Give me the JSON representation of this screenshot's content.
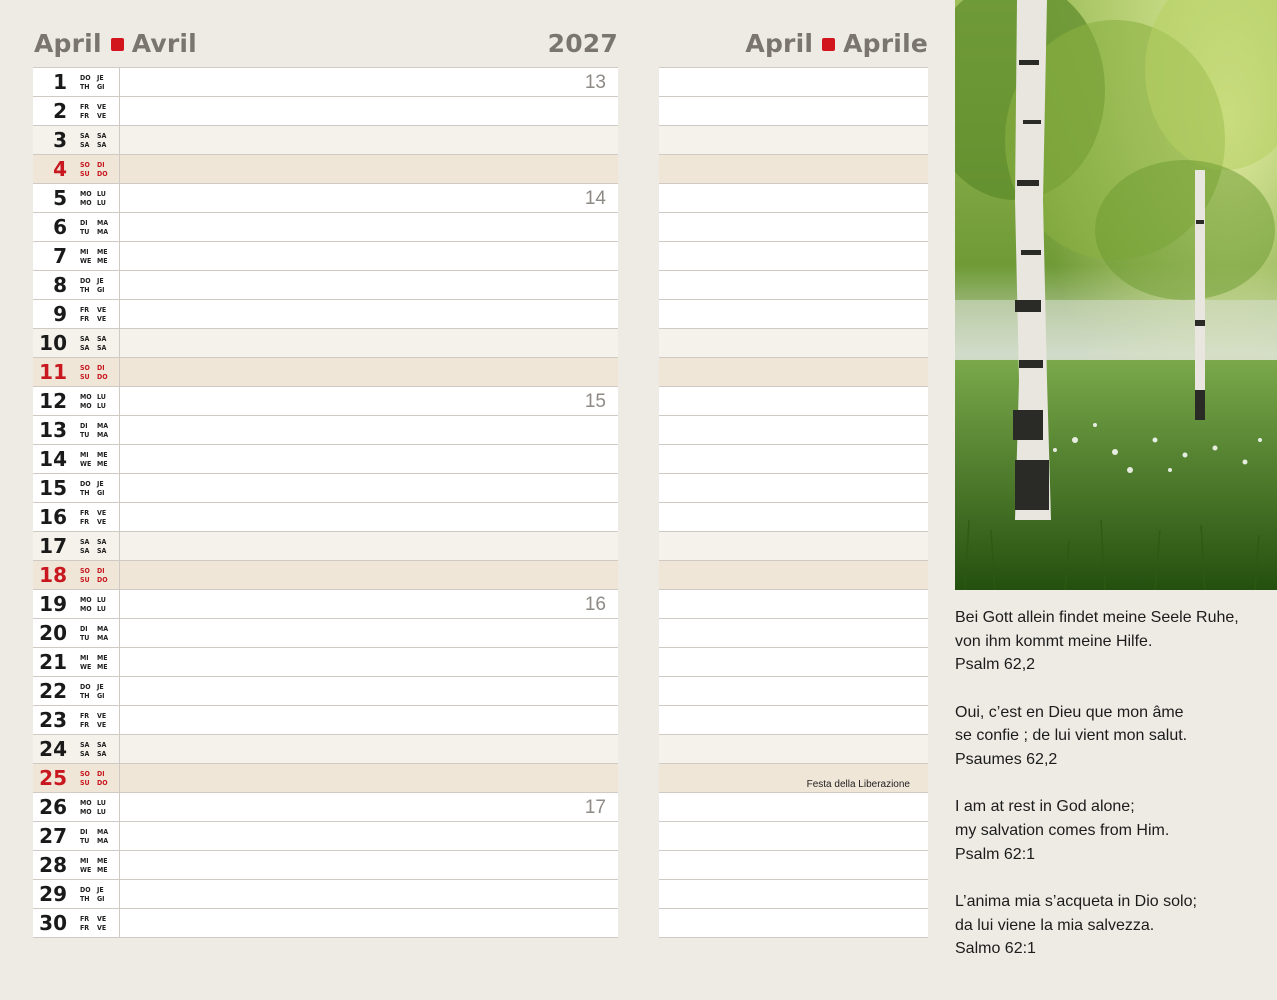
{
  "header": {
    "left_month_de": "April",
    "left_month_fr": "Avril",
    "year": "2027",
    "right_month_en": "April",
    "right_month_it": "Aprile"
  },
  "days": [
    {
      "num": "1",
      "wd1": "DO",
      "wd2": "JE",
      "wd3": "TH",
      "wd4": "GI",
      "type": "weekday",
      "week": "13"
    },
    {
      "num": "2",
      "wd1": "FR",
      "wd2": "VE",
      "wd3": "FR",
      "wd4": "VE",
      "type": "weekday"
    },
    {
      "num": "3",
      "wd1": "SA",
      "wd2": "SA",
      "wd3": "SA",
      "wd4": "SA",
      "type": "sat"
    },
    {
      "num": "4",
      "wd1": "SO",
      "wd2": "DI",
      "wd3": "SU",
      "wd4": "DO",
      "type": "sun"
    },
    {
      "num": "5",
      "wd1": "MO",
      "wd2": "LU",
      "wd3": "MO",
      "wd4": "LU",
      "type": "weekday",
      "week": "14"
    },
    {
      "num": "6",
      "wd1": "DI",
      "wd2": "MA",
      "wd3": "TU",
      "wd4": "MA",
      "type": "weekday"
    },
    {
      "num": "7",
      "wd1": "MI",
      "wd2": "ME",
      "wd3": "WE",
      "wd4": "ME",
      "type": "weekday"
    },
    {
      "num": "8",
      "wd1": "DO",
      "wd2": "JE",
      "wd3": "TH",
      "wd4": "GI",
      "type": "weekday"
    },
    {
      "num": "9",
      "wd1": "FR",
      "wd2": "VE",
      "wd3": "FR",
      "wd4": "VE",
      "type": "weekday"
    },
    {
      "num": "10",
      "wd1": "SA",
      "wd2": "SA",
      "wd3": "SA",
      "wd4": "SA",
      "type": "sat"
    },
    {
      "num": "11",
      "wd1": "SO",
      "wd2": "DI",
      "wd3": "SU",
      "wd4": "DO",
      "type": "sun"
    },
    {
      "num": "12",
      "wd1": "MO",
      "wd2": "LU",
      "wd3": "MO",
      "wd4": "LU",
      "type": "weekday",
      "week": "15"
    },
    {
      "num": "13",
      "wd1": "DI",
      "wd2": "MA",
      "wd3": "TU",
      "wd4": "MA",
      "type": "weekday"
    },
    {
      "num": "14",
      "wd1": "MI",
      "wd2": "ME",
      "wd3": "WE",
      "wd4": "ME",
      "type": "weekday"
    },
    {
      "num": "15",
      "wd1": "DO",
      "wd2": "JE",
      "wd3": "TH",
      "wd4": "GI",
      "type": "weekday"
    },
    {
      "num": "16",
      "wd1": "FR",
      "wd2": "VE",
      "wd3": "FR",
      "wd4": "VE",
      "type": "weekday"
    },
    {
      "num": "17",
      "wd1": "SA",
      "wd2": "SA",
      "wd3": "SA",
      "wd4": "SA",
      "type": "sat"
    },
    {
      "num": "18",
      "wd1": "SO",
      "wd2": "DI",
      "wd3": "SU",
      "wd4": "DO",
      "type": "sun"
    },
    {
      "num": "19",
      "wd1": "MO",
      "wd2": "LU",
      "wd3": "MO",
      "wd4": "LU",
      "type": "weekday",
      "week": "16"
    },
    {
      "num": "20",
      "wd1": "DI",
      "wd2": "MA",
      "wd3": "TU",
      "wd4": "MA",
      "type": "weekday"
    },
    {
      "num": "21",
      "wd1": "MI",
      "wd2": "ME",
      "wd3": "WE",
      "wd4": "ME",
      "type": "weekday"
    },
    {
      "num": "22",
      "wd1": "DO",
      "wd2": "JE",
      "wd3": "TH",
      "wd4": "GI",
      "type": "weekday"
    },
    {
      "num": "23",
      "wd1": "FR",
      "wd2": "VE",
      "wd3": "FR",
      "wd4": "VE",
      "type": "weekday"
    },
    {
      "num": "24",
      "wd1": "SA",
      "wd2": "SA",
      "wd3": "SA",
      "wd4": "SA",
      "type": "sat"
    },
    {
      "num": "25",
      "wd1": "SO",
      "wd2": "DI",
      "wd3": "SU",
      "wd4": "DO",
      "type": "sun",
      "holiday": "Festa della Liberazione"
    },
    {
      "num": "26",
      "wd1": "MO",
      "wd2": "LU",
      "wd3": "MO",
      "wd4": "LU",
      "type": "weekday",
      "week": "17"
    },
    {
      "num": "27",
      "wd1": "DI",
      "wd2": "MA",
      "wd3": "TU",
      "wd4": "MA",
      "type": "weekday"
    },
    {
      "num": "28",
      "wd1": "MI",
      "wd2": "ME",
      "wd3": "WE",
      "wd4": "ME",
      "type": "weekday"
    },
    {
      "num": "29",
      "wd1": "DO",
      "wd2": "JE",
      "wd3": "TH",
      "wd4": "GI",
      "type": "weekday"
    },
    {
      "num": "30",
      "wd1": "FR",
      "wd2": "VE",
      "wd3": "FR",
      "wd4": "VE",
      "type": "weekday"
    }
  ],
  "quotes": {
    "de": "Bei Gott allein findet meine Seele Ruhe,\nvon ihm kommt meine Hilfe.\nPsalm 62,2",
    "fr": "Oui, c’est en Dieu que mon âme\nse confie ; de lui vient mon salut.\nPsaumes 62,2",
    "en": "I am at rest in God alone;\nmy salvation comes from Him.\nPsalm 62:1",
    "it": "L’anima mia s’acqueta in Dio solo;\nda lui viene la mia salvezza.\nSalmo 62:1"
  },
  "colors": {
    "accent_red": "#d2141c",
    "sunday_row": "#efe6d8",
    "saturday_row": "#f5f2ec",
    "page_bg": "#eeebe4"
  },
  "photo": {
    "subject": "birch-trees-meadow"
  }
}
